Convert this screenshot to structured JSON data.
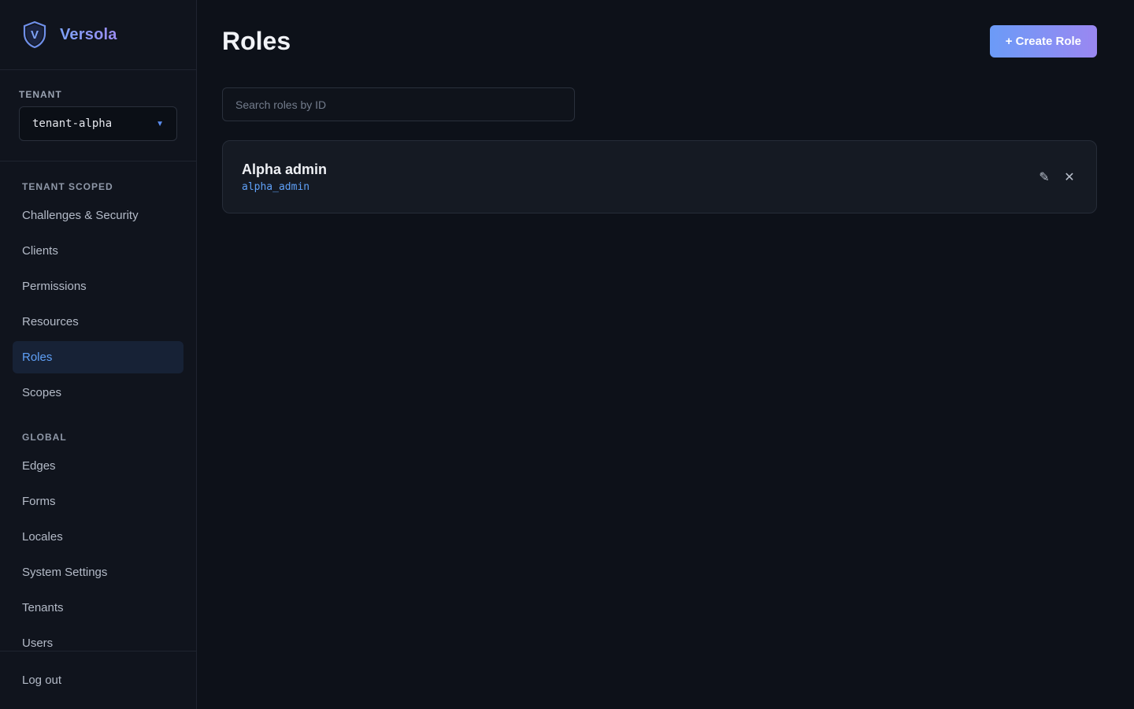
{
  "brand": {
    "name": "Versola",
    "logo_letter": "V"
  },
  "tenant": {
    "label": "TENANT",
    "value": "tenant-alpha"
  },
  "nav": {
    "tenant_scoped_title": "TENANT SCOPED",
    "tenant_scoped": [
      {
        "label": "Challenges & Security"
      },
      {
        "label": "Clients"
      },
      {
        "label": "Permissions"
      },
      {
        "label": "Resources"
      },
      {
        "label": "Roles",
        "active": true
      },
      {
        "label": "Scopes"
      }
    ],
    "global_title": "GLOBAL",
    "global": [
      {
        "label": "Edges"
      },
      {
        "label": "Forms"
      },
      {
        "label": "Locales"
      },
      {
        "label": "System Settings"
      },
      {
        "label": "Tenants"
      },
      {
        "label": "Users"
      }
    ],
    "logout": "Log out"
  },
  "main": {
    "title": "Roles",
    "create_button": "+ Create Role",
    "search": {
      "placeholder": "Search roles by ID",
      "value": ""
    },
    "roles": [
      {
        "name": "Alpha admin",
        "id": "alpha_admin"
      }
    ]
  },
  "colors": {
    "accent": "#5fa0f7",
    "button_gradient_start": "#6b9bf7",
    "button_gradient_end": "#9a87f1",
    "background": "#0d1119"
  },
  "icons": [
    "shield-logo-icon",
    "caret-down-icon",
    "edit-icon",
    "close-icon"
  ]
}
